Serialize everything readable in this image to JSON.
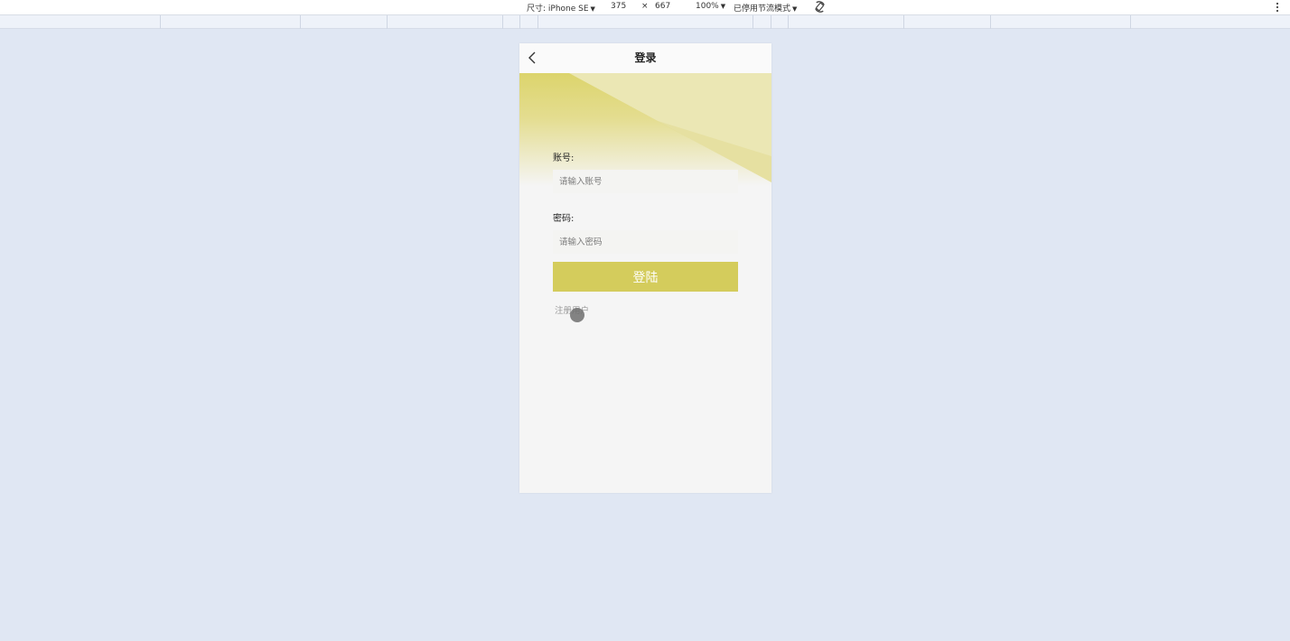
{
  "devtools": {
    "device_label": "尺寸: iPhone SE",
    "width": "375",
    "times": "×",
    "height": "667",
    "zoom": "100%",
    "throttle": "已停用节流模式",
    "icons": [
      "rotate-icon",
      "more-options-icon"
    ]
  },
  "page": {
    "nav_title": "登录",
    "back_icon": "chevron-left-icon",
    "account_label": "账号:",
    "account_placeholder": "请输入账号",
    "account_value": "",
    "password_label": "密码:",
    "password_placeholder": "请输入密码",
    "password_value": "",
    "login_button": "登陆",
    "register_link": "注册用户"
  },
  "colors": {
    "accent": "#d4cc5c",
    "page_background": "#e0e7f3",
    "phone_background": "#f5f5f5"
  }
}
